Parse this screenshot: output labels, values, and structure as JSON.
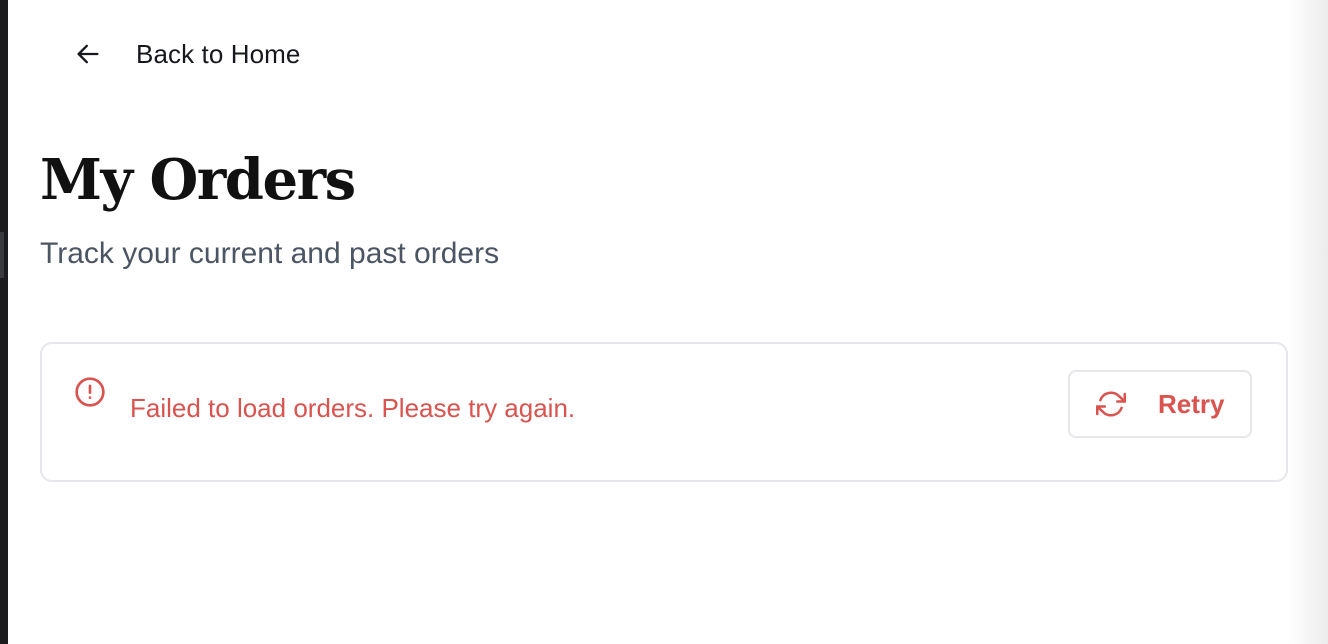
{
  "nav": {
    "back_label": "Back to Home",
    "back_icon": "arrow-left-icon"
  },
  "header": {
    "title": "My Orders",
    "subtitle": "Track your current and past orders"
  },
  "error": {
    "icon": "alert-circle-icon",
    "message": "Failed to load orders. Please try again.",
    "retry_label": "Retry",
    "retry_icon": "refresh-icon"
  },
  "colors": {
    "error": "#d9534f",
    "title": "#111111",
    "subtitle": "#4b5563",
    "border": "#e5e7eb"
  }
}
